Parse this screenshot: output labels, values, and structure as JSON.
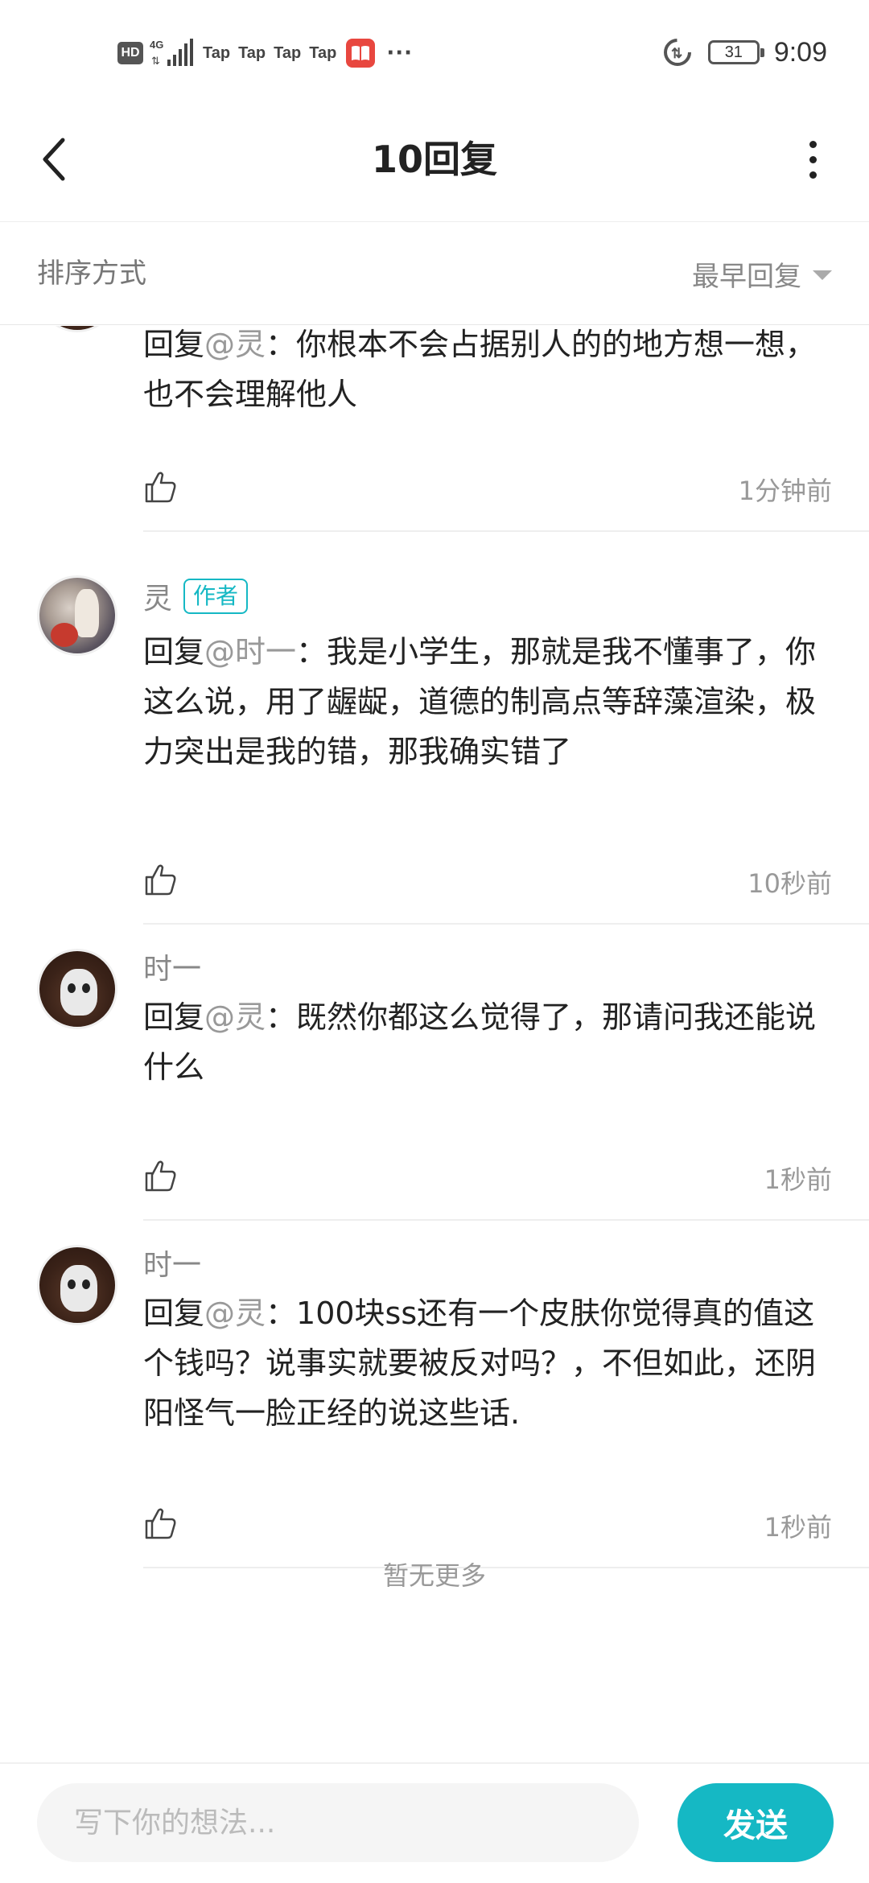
{
  "status_bar": {
    "hd": "HD",
    "network": "4G",
    "notifications": [
      "Tap",
      "Tap",
      "Tap",
      "Tap"
    ],
    "more": "···",
    "battery": "31",
    "time": "9:09"
  },
  "header": {
    "title": "10回复",
    "back_icon": "chevron-left-icon",
    "menu_icon": "more-vertical-icon"
  },
  "sort": {
    "label": "排序方式",
    "value": "最早回复"
  },
  "replies": [
    {
      "author": "",
      "avatar": "white-mask-avatar",
      "prefix": "回复",
      "mention": "@灵",
      "text": "：你根本不会占据别人的的地方想一想，也不会理解他人",
      "time": "1分钟前"
    },
    {
      "author": "灵",
      "badge": "作者",
      "avatar": "anime-art-avatar",
      "prefix": "回复",
      "mention": "@时一",
      "text": "：我是小学生，那就是我不懂事了，你这么说，用了龌龊，道德的制高点等辞藻渲染，极力突出是我的错，那我确实错了",
      "time": "10秒前"
    },
    {
      "author": "时一",
      "avatar": "white-mask-avatar",
      "prefix": "回复",
      "mention": "@灵",
      "text": "：既然你都这么觉得了，那请问我还能说什么",
      "time": "1秒前"
    },
    {
      "author": "时一",
      "avatar": "white-mask-avatar",
      "prefix": "回复",
      "mention": "@灵",
      "text": "：100块ss还有一个皮肤你觉得真的值这个钱吗？说事实就要被反对吗？，不但如此，还阴阳怪气一脸正经的说这些话.",
      "time": "1秒前"
    }
  ],
  "footer_note": "暂无更多",
  "composer": {
    "placeholder": "写下你的想法...",
    "value": "",
    "send_label": "发送"
  },
  "colors": {
    "accent": "#15b8c4",
    "text_primary": "#222222",
    "text_secondary": "#999999"
  }
}
